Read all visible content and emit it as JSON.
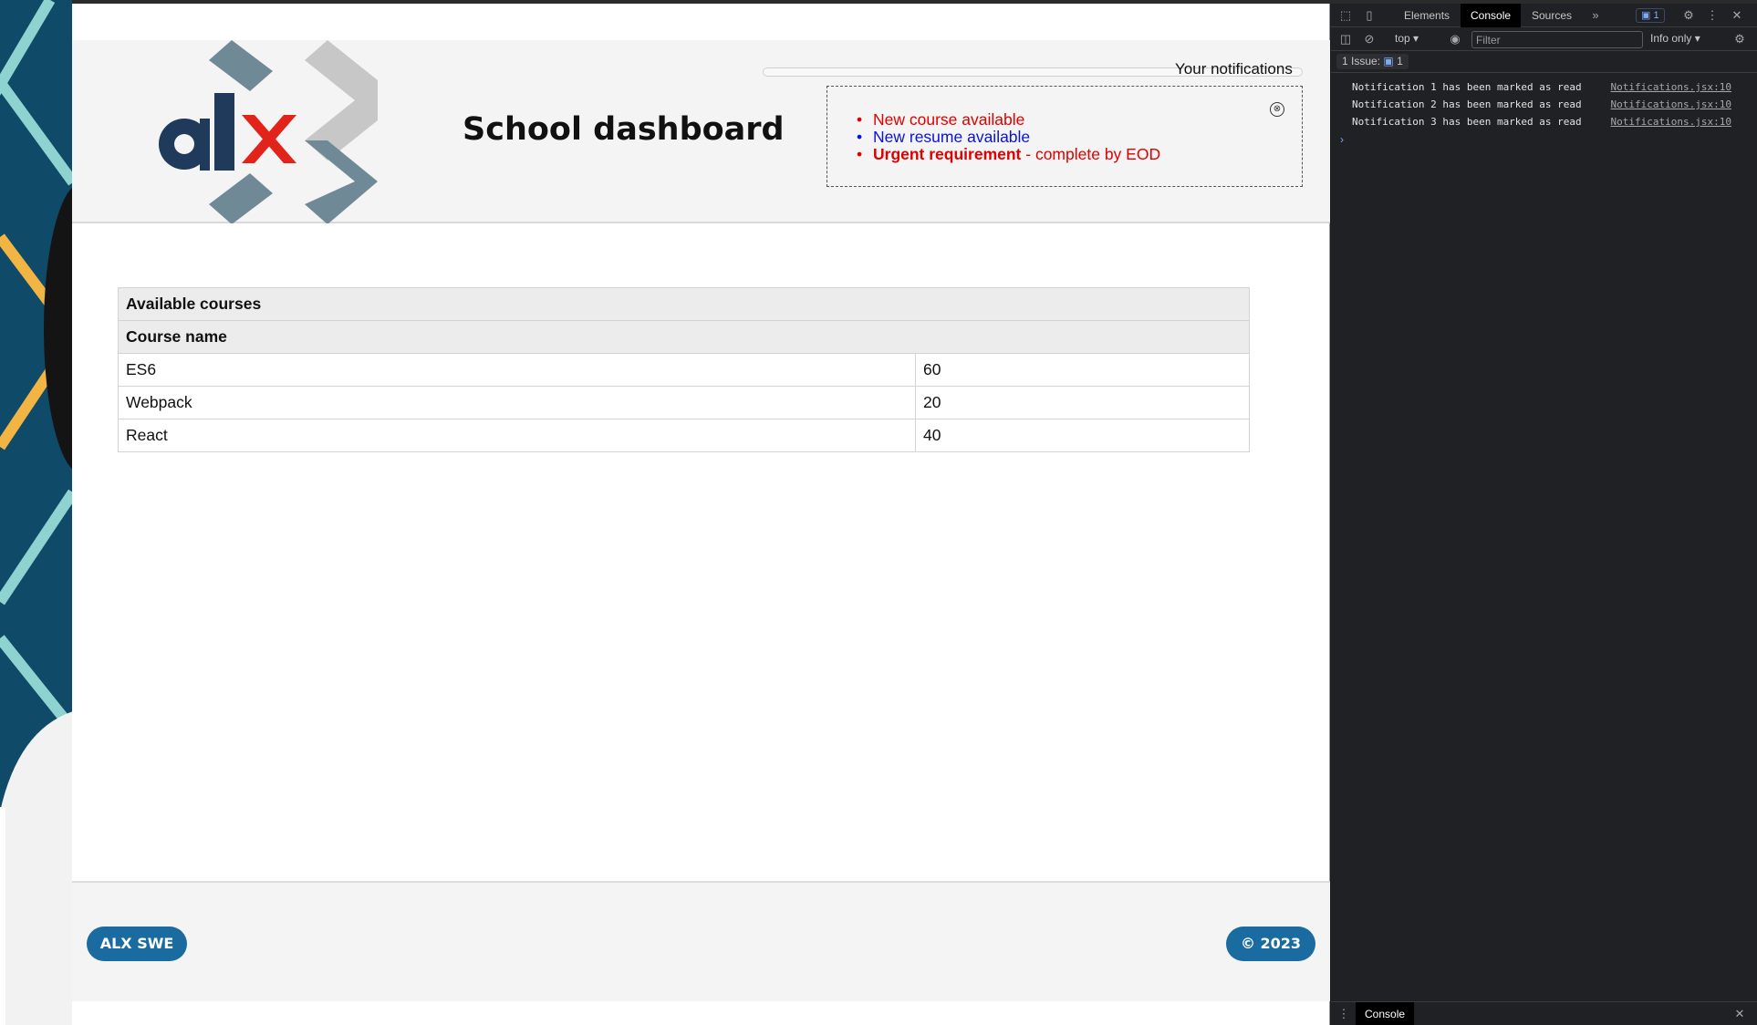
{
  "app": {
    "title": "School dashboard",
    "notifications": {
      "title": "Your notifications",
      "close_glyph": "⊗",
      "items": [
        {
          "text": "New course available",
          "type": "default"
        },
        {
          "text": "New resume available",
          "type": "urgent-blue"
        },
        {
          "strong": "Urgent requirement",
          "rest": " - complete by EOD",
          "type": "urgent"
        }
      ]
    },
    "table": {
      "caption": "Available courses",
      "header": "Course name",
      "rows": [
        {
          "name": "ES6",
          "credit": "60"
        },
        {
          "name": "Webpack",
          "credit": "20"
        },
        {
          "name": "React",
          "credit": "40"
        }
      ]
    },
    "footer": {
      "left": "ALX SWE",
      "right": "© 2023"
    },
    "colors": {
      "brand_blue": "#1a6ba0",
      "notif_red": "#e00000",
      "notif_blue": "#0a14d6",
      "logo_navy": "#1f3a5a",
      "logo_red": "#e2231a"
    }
  },
  "devtools": {
    "tabs": [
      "Elements",
      "Console",
      "Sources"
    ],
    "active_tab": "Console",
    "more_tabs": "»",
    "issue_badge": "1",
    "context": "top ▾",
    "filter_placeholder": "Filter",
    "levels": "Info only ▾",
    "issues_label": "1 Issue:",
    "issues_count": "1",
    "logs": [
      {
        "message": "Notification 1 has been marked as read",
        "source": "Notifications.jsx:10"
      },
      {
        "message": "Notification 2 has been marked as read",
        "source": "Notifications.jsx:10"
      },
      {
        "message": "Notification 3 has been marked as read",
        "source": "Notifications.jsx:10"
      }
    ],
    "prompt": "›",
    "drawer_tab": "Console"
  }
}
